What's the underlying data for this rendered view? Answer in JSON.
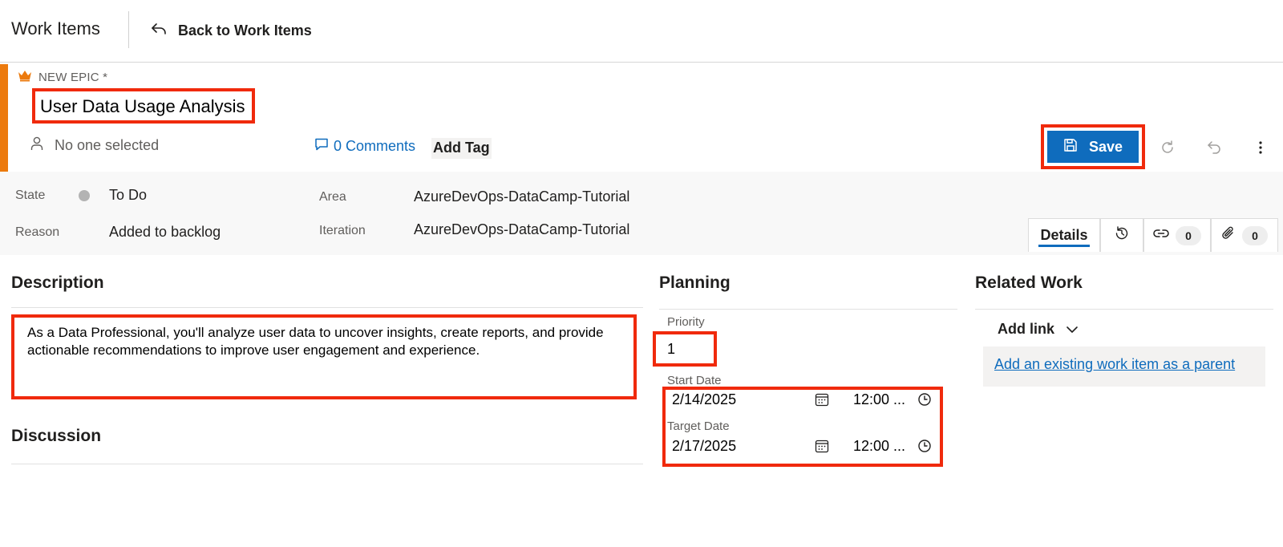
{
  "header": {
    "app_title": "Work Items",
    "back_label": "Back to Work Items"
  },
  "work_item": {
    "type_label": "NEW EPIC *",
    "title": "User Data Usage Analysis",
    "assignee": "No one selected",
    "comments_label": "0 Comments",
    "add_tag_label": "Add Tag",
    "save_label": "Save",
    "accent_color": "#ec7a0d"
  },
  "fields": {
    "state_label": "State",
    "state_value": "To Do",
    "reason_label": "Reason",
    "reason_value": "Added to backlog",
    "area_label": "Area",
    "area_value": "AzureDevOps-DataCamp-Tutorial",
    "iteration_label": "Iteration",
    "iteration_value": "AzureDevOps-DataCamp-Tutorial"
  },
  "tabs": {
    "details_label": "Details",
    "links_count": "0",
    "attachments_count": "0"
  },
  "description": {
    "title": "Description",
    "text": "As a Data Professional, you'll analyze user data to uncover insights, create reports, and provide actionable recommendations to improve user engagement and experience."
  },
  "discussion": {
    "title": "Discussion"
  },
  "planning": {
    "title": "Planning",
    "priority_label": "Priority",
    "priority_value": "1",
    "start_label": "Start Date",
    "start_date": "2/14/2025",
    "start_time": "12:00 ...",
    "target_label": "Target Date",
    "target_date": "2/17/2025",
    "target_time": "12:00 ..."
  },
  "related": {
    "title": "Related Work",
    "add_link_label": "Add link",
    "parent_link_label": "Add an existing work item as a parent"
  },
  "colors": {
    "primary": "#0f6cbd",
    "highlight": "#f02a0c"
  }
}
